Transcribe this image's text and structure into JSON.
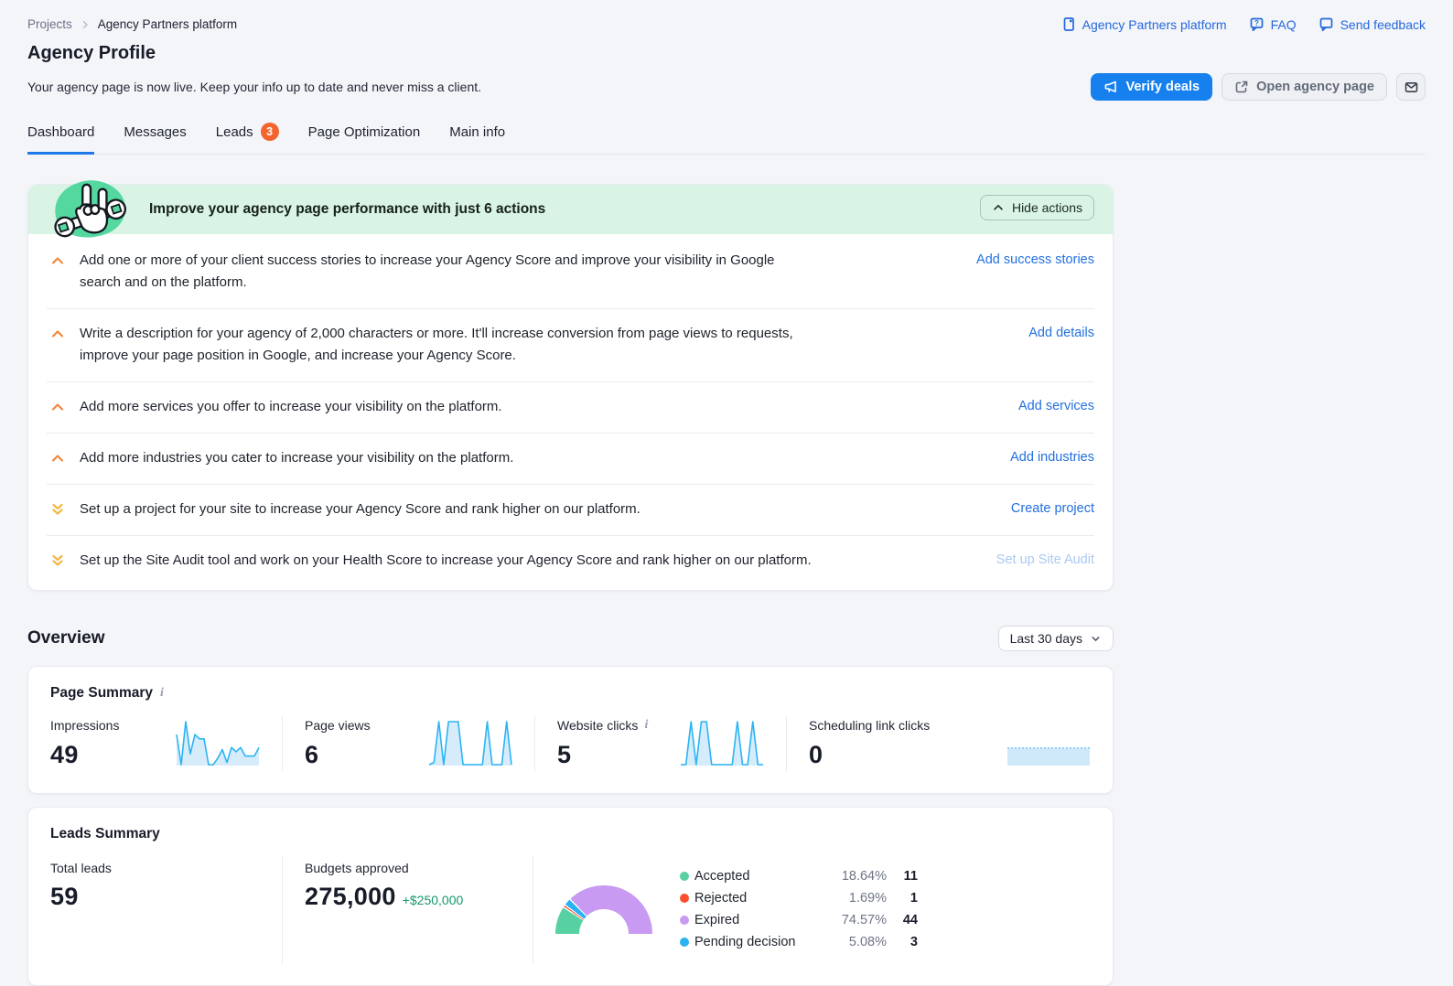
{
  "breadcrumb": {
    "root": "Projects",
    "current": "Agency Partners platform"
  },
  "header": {
    "title": "Agency Profile",
    "subtitle": "Your agency page is now live. Keep your info up to date and never miss a client.",
    "links": [
      {
        "label": "Agency Partners platform",
        "icon": "doc-icon"
      },
      {
        "label": "FAQ",
        "icon": "faq-bubble-icon"
      },
      {
        "label": "Send feedback",
        "icon": "feedback-bubble-icon"
      }
    ],
    "verify_deals_label": "Verify deals",
    "open_agency_page_label": "Open agency page"
  },
  "tabs": [
    {
      "label": "Dashboard",
      "active": true
    },
    {
      "label": "Messages",
      "active": false
    },
    {
      "label": "Leads",
      "active": false,
      "badge": "3"
    },
    {
      "label": "Page Optimization",
      "active": false
    },
    {
      "label": "Main info",
      "active": false
    }
  ],
  "actions_panel": {
    "title": "Improve your agency page performance with just 6 actions",
    "hide_button_label": "Hide actions",
    "items": [
      {
        "text": "Add one or more of your client success stories to increase your Agency Score and improve your visibility in Google search and on the platform.",
        "link": "Add success stories",
        "priority": "high",
        "disabled": false
      },
      {
        "text": "Write a description for your agency of 2,000 characters or more. It'll increase conversion from page views to requests, improve your page position in Google, and increase your Agency Score.",
        "link": "Add details",
        "priority": "high",
        "disabled": false
      },
      {
        "text": "Add more services you offer to increase your visibility on the platform.",
        "link": "Add services",
        "priority": "high",
        "disabled": false
      },
      {
        "text": "Add more industries you cater to increase your visibility on the platform.",
        "link": "Add industries",
        "priority": "high",
        "disabled": false
      },
      {
        "text": "Set up a project for your site to increase your Agency Score and rank higher on our platform.",
        "link": "Create project",
        "priority": "low",
        "disabled": false
      },
      {
        "text": "Set up the Site Audit tool and work on your Health Score to increase your Agency Score and rank higher on our platform.",
        "link": "Set up Site Audit",
        "priority": "low",
        "disabled": true
      }
    ]
  },
  "overview": {
    "title": "Overview",
    "date_range": "Last 30 days",
    "page_summary": {
      "title": "Page Summary",
      "metrics": [
        {
          "label": "Impressions",
          "value": "49",
          "info": false
        },
        {
          "label": "Page views",
          "value": "6",
          "info": false
        },
        {
          "label": "Website clicks",
          "value": "5",
          "info": true
        },
        {
          "label": "Scheduling link clicks",
          "value": "0",
          "info": false
        }
      ]
    },
    "leads_summary": {
      "title": "Leads Summary",
      "total_leads_label": "Total leads",
      "total_leads_value": "59",
      "budgets_label": "Budgets approved",
      "budgets_value": "275,000",
      "budgets_delta": "+$250,000"
    }
  },
  "chart_data": {
    "sparklines": [
      {
        "type": "line",
        "name": "Impressions",
        "values": [
          7,
          0,
          10,
          2.5,
          7,
          6,
          6,
          0,
          0,
          1.5,
          3.5,
          0.5,
          4,
          3,
          4,
          2,
          2,
          2,
          4
        ]
      },
      {
        "type": "line",
        "name": "Page views",
        "values": [
          0,
          0.3,
          6,
          0,
          6,
          6,
          6,
          0,
          0,
          0,
          0,
          0,
          6,
          0,
          0,
          0,
          6,
          0
        ]
      },
      {
        "type": "line",
        "name": "Website clicks",
        "values": [
          0,
          0,
          5,
          0,
          5,
          5,
          0,
          0,
          0,
          0,
          0,
          5,
          0,
          0,
          5,
          0,
          0
        ]
      },
      {
        "type": "line",
        "name": "Scheduling link clicks",
        "values": [
          0,
          0,
          0,
          0,
          0,
          0,
          0,
          0,
          0,
          0
        ]
      }
    ],
    "spark_colors": {
      "line": "#2bb4f4",
      "fill": "#d7ecfb",
      "flat_band": "#cfe9fb",
      "flat_edge": "#7fc6f5"
    },
    "leads_donut": {
      "type": "pie",
      "shape": "half-donut",
      "draw_order": [
        "Accepted",
        "Rejected",
        "Pending decision",
        "Expired"
      ],
      "segments": [
        {
          "label": "Accepted",
          "percent": "18.64%",
          "count": "11",
          "color": "#57d1a1"
        },
        {
          "label": "Rejected",
          "percent": "1.69%",
          "count": "1",
          "color": "#fb4f2e"
        },
        {
          "label": "Expired",
          "percent": "74.57%",
          "count": "44",
          "color": "#c89af2"
        },
        {
          "label": "Pending decision",
          "percent": "5.08%",
          "count": "3",
          "color": "#2ab2f2"
        }
      ]
    }
  }
}
